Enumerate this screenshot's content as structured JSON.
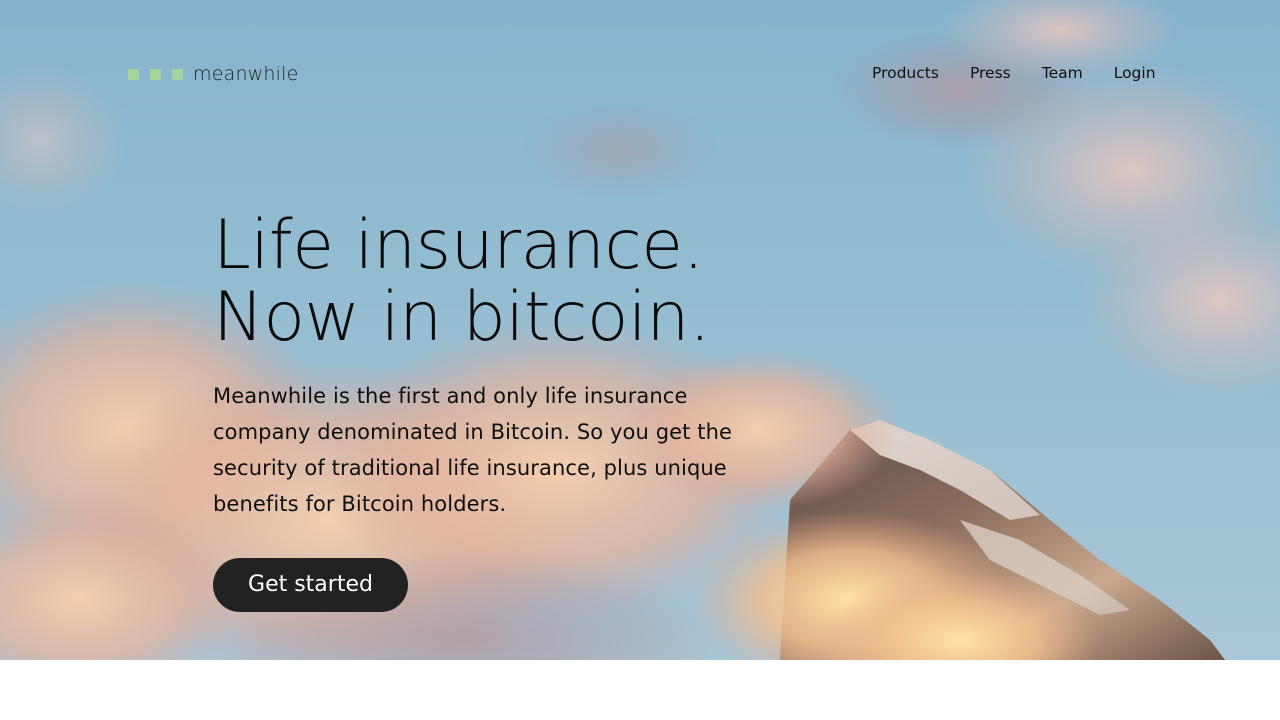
{
  "brand": {
    "name": "meanwhile",
    "logo_icon": "three-green-squares-logo",
    "accent_color": "#a6d39c"
  },
  "nav": {
    "items": [
      {
        "label": "Products"
      },
      {
        "label": "Press"
      },
      {
        "label": "Team"
      },
      {
        "label": "Login"
      }
    ]
  },
  "hero": {
    "headline_line1": "Life insurance.",
    "headline_line2": "Now in bitcoin.",
    "description": "Meanwhile is the first and only life insurance company denominated in Bitcoin. So you get the security of traditional life insurance, plus unique benefits for Bitcoin holders.",
    "cta_label": "Get started",
    "cta_color": "#222222",
    "background_image": "snowy-mountain-peak-above-clouds-at-sunset"
  }
}
